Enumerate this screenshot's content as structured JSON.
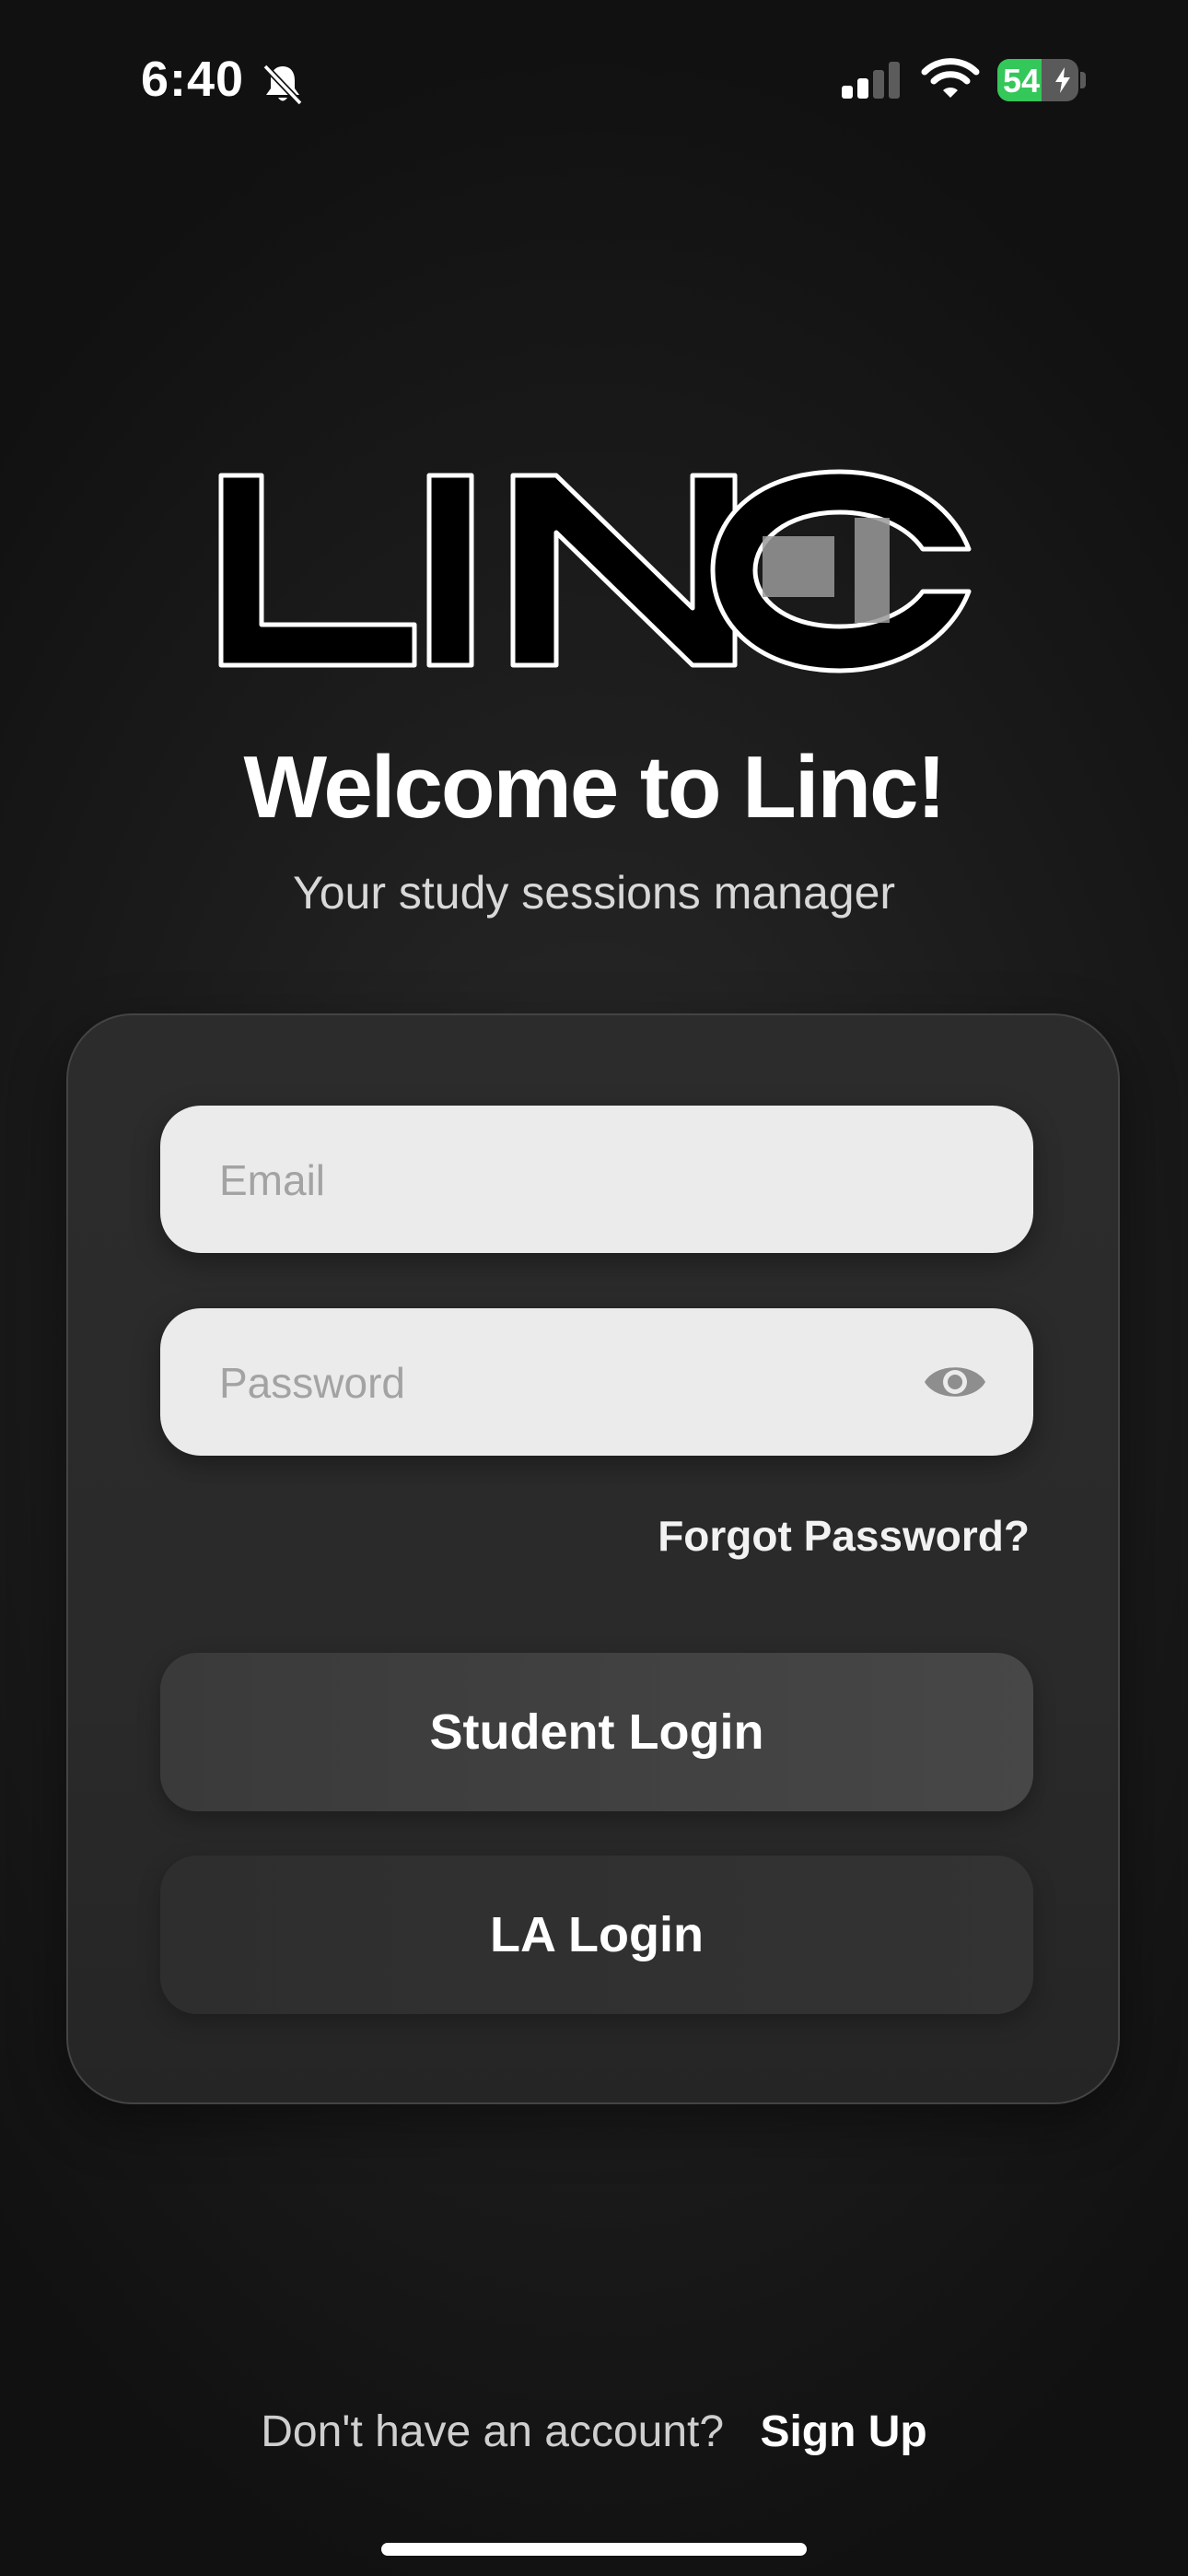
{
  "status_bar": {
    "time": "6:40",
    "battery_percent": "54",
    "battery_level": 0.54,
    "icons": [
      "bell-slash-icon",
      "cellular-signal-icon",
      "wifi-icon",
      "battery-charging-icon"
    ]
  },
  "logo": {
    "icon": "linc-logo"
  },
  "welcome": {
    "title": "Welcome to Linc!",
    "subtitle": "Your study sessions manager"
  },
  "form": {
    "email_placeholder": "Email",
    "password_placeholder": "Password",
    "password_toggle_icon": "eye-icon",
    "forgot_password": "Forgot Password?",
    "student_login": "Student Login",
    "la_login": "LA Login"
  },
  "footer": {
    "prompt": "Don't have an account?",
    "signup": "Sign Up"
  },
  "colors": {
    "background": "#121212",
    "card": "#2a2a2a",
    "field": "#ebebeb",
    "battery_green": "#34c759"
  }
}
